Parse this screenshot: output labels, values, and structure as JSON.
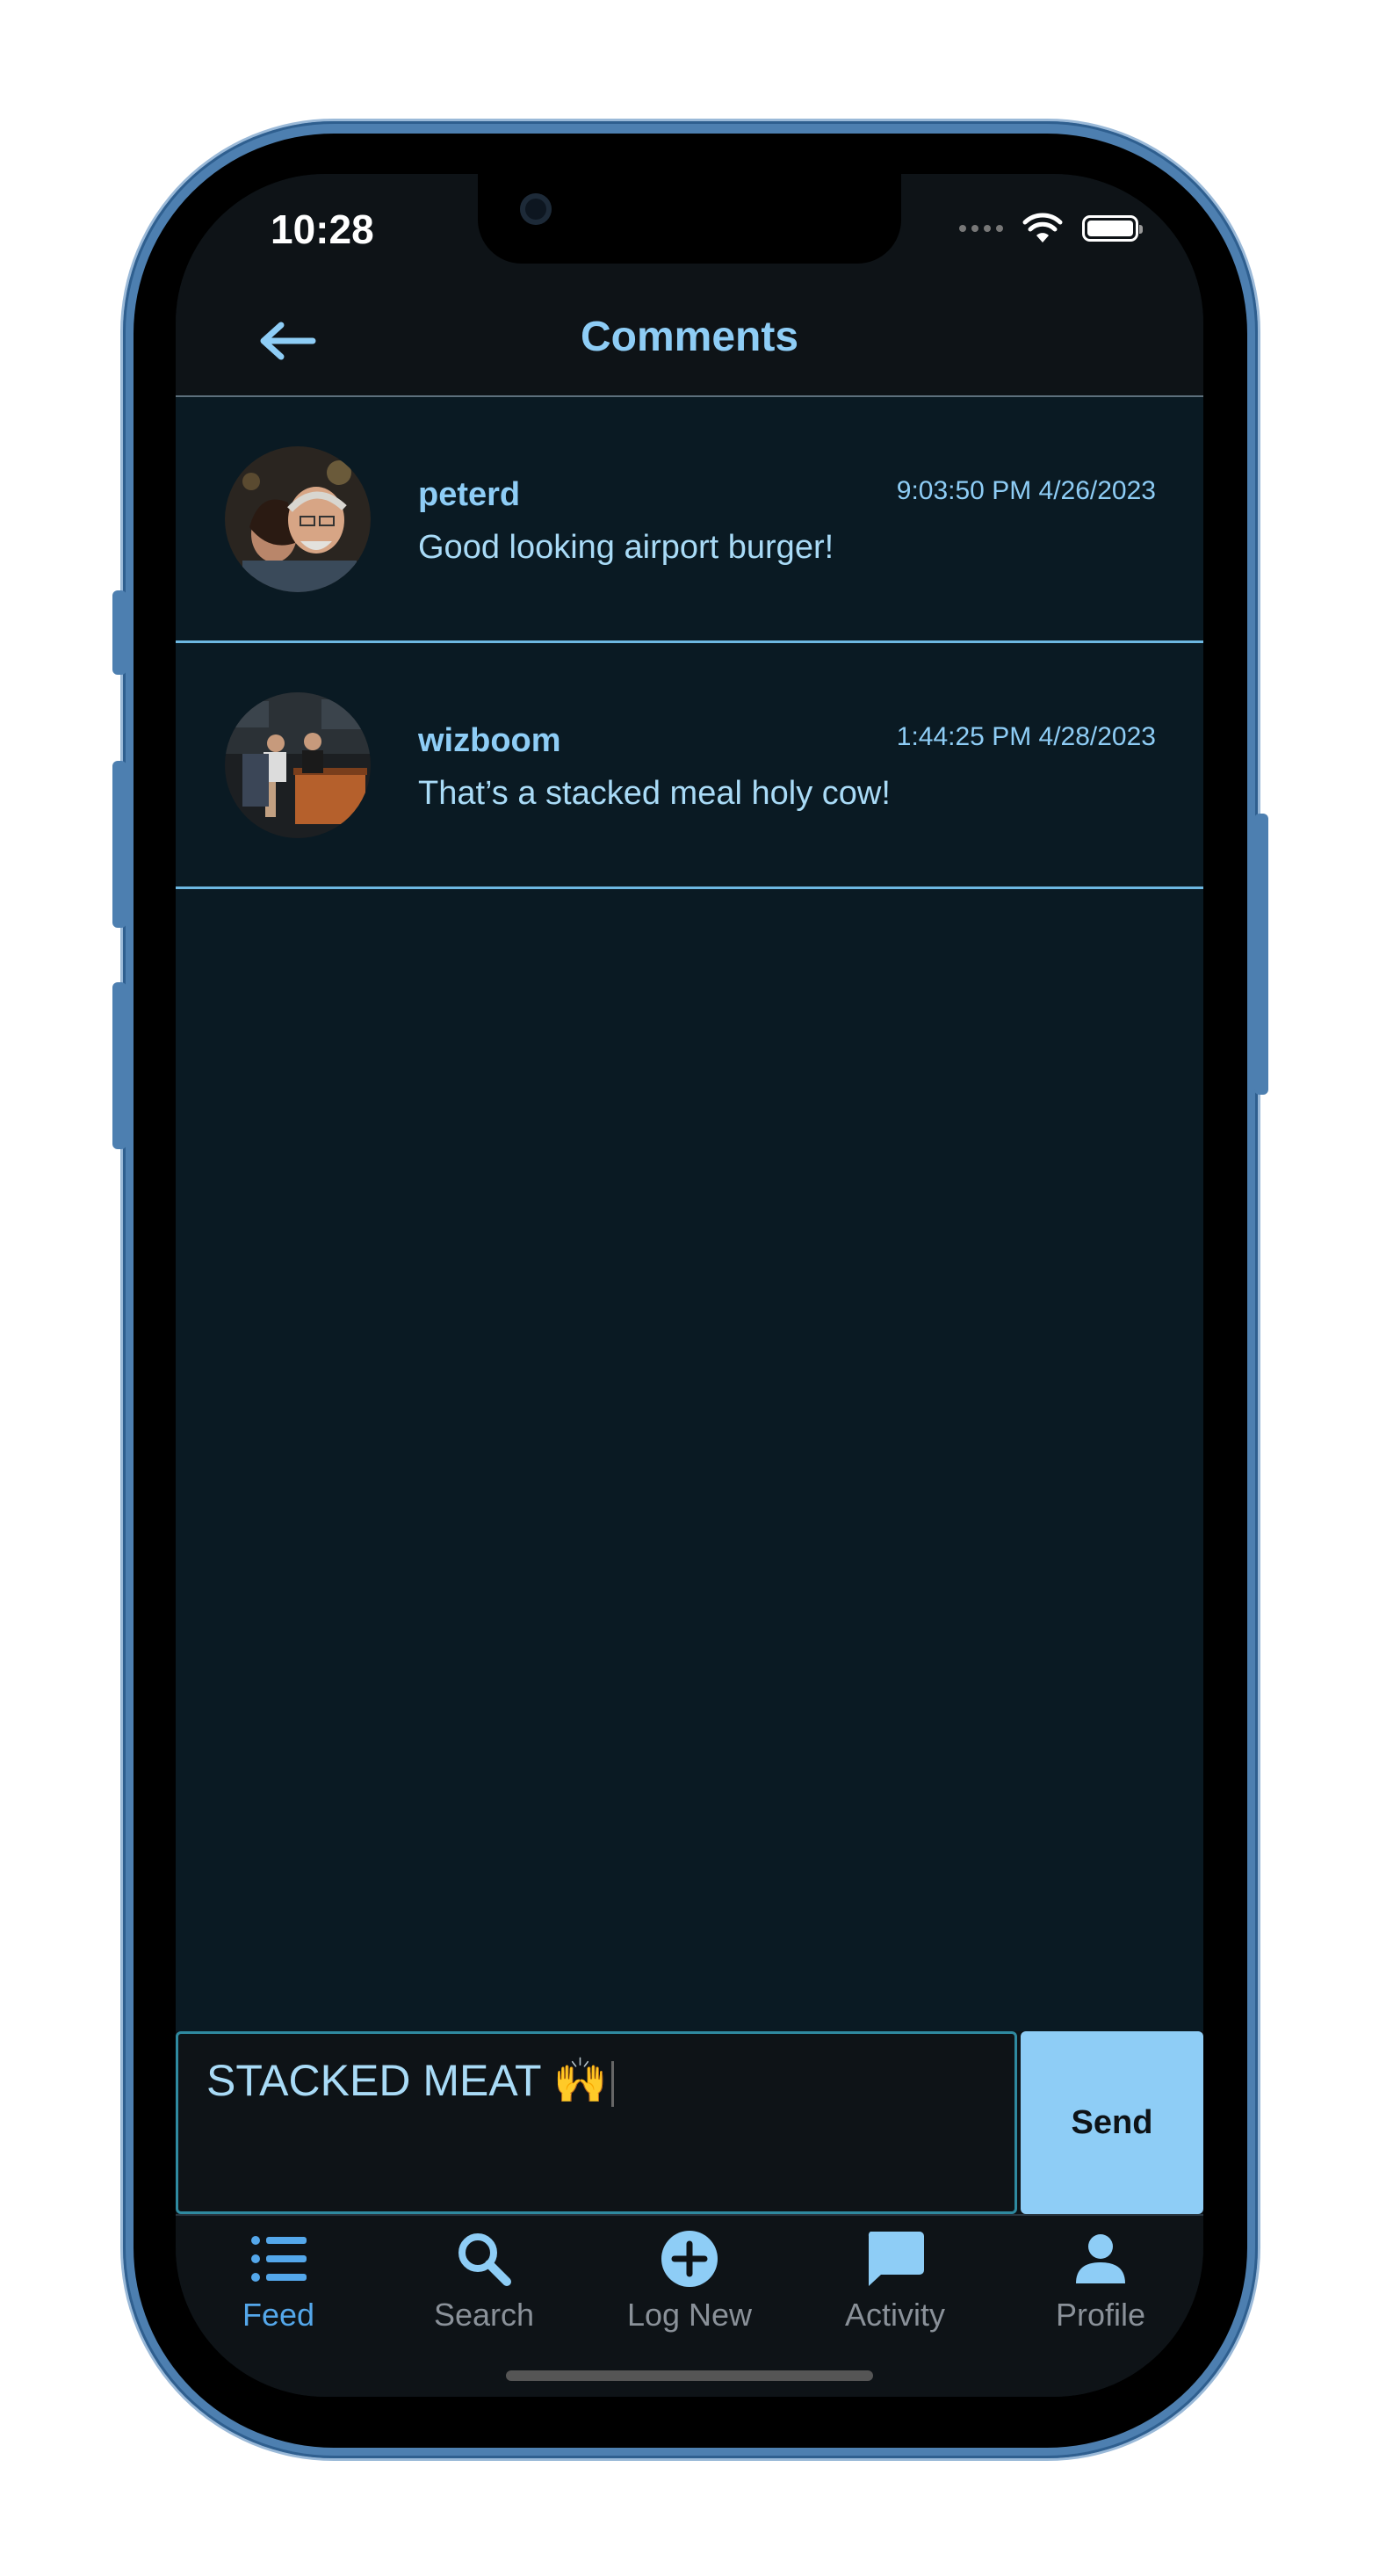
{
  "status_bar": {
    "time": "10:28"
  },
  "header": {
    "title": "Comments"
  },
  "comments": [
    {
      "username": "peterd",
      "timestamp": "9:03:50 PM 4/26/2023",
      "text": "Good looking airport burger!"
    },
    {
      "username": "wizboom",
      "timestamp": "1:44:25 PM 4/28/2023",
      "text": "That’s a stacked meal holy cow!"
    }
  ],
  "composer": {
    "input_value": "STACKED MEAT 🙌",
    "send_label": "Send"
  },
  "tabbar": {
    "tabs": [
      {
        "label": "Feed",
        "icon": "list-icon",
        "active": true
      },
      {
        "label": "Search",
        "icon": "search-icon",
        "active": false
      },
      {
        "label": "Log New",
        "icon": "plus-circle-icon",
        "active": false
      },
      {
        "label": "Activity",
        "icon": "chat-bubble-icon",
        "active": false
      },
      {
        "label": "Profile",
        "icon": "person-icon",
        "active": false
      }
    ]
  },
  "colors": {
    "accent": "#8ecdf6",
    "active_tab": "#54a7ea",
    "inactive_tab": "#8a9199",
    "background": "#0a1a23",
    "divider": "#6db8e2"
  }
}
